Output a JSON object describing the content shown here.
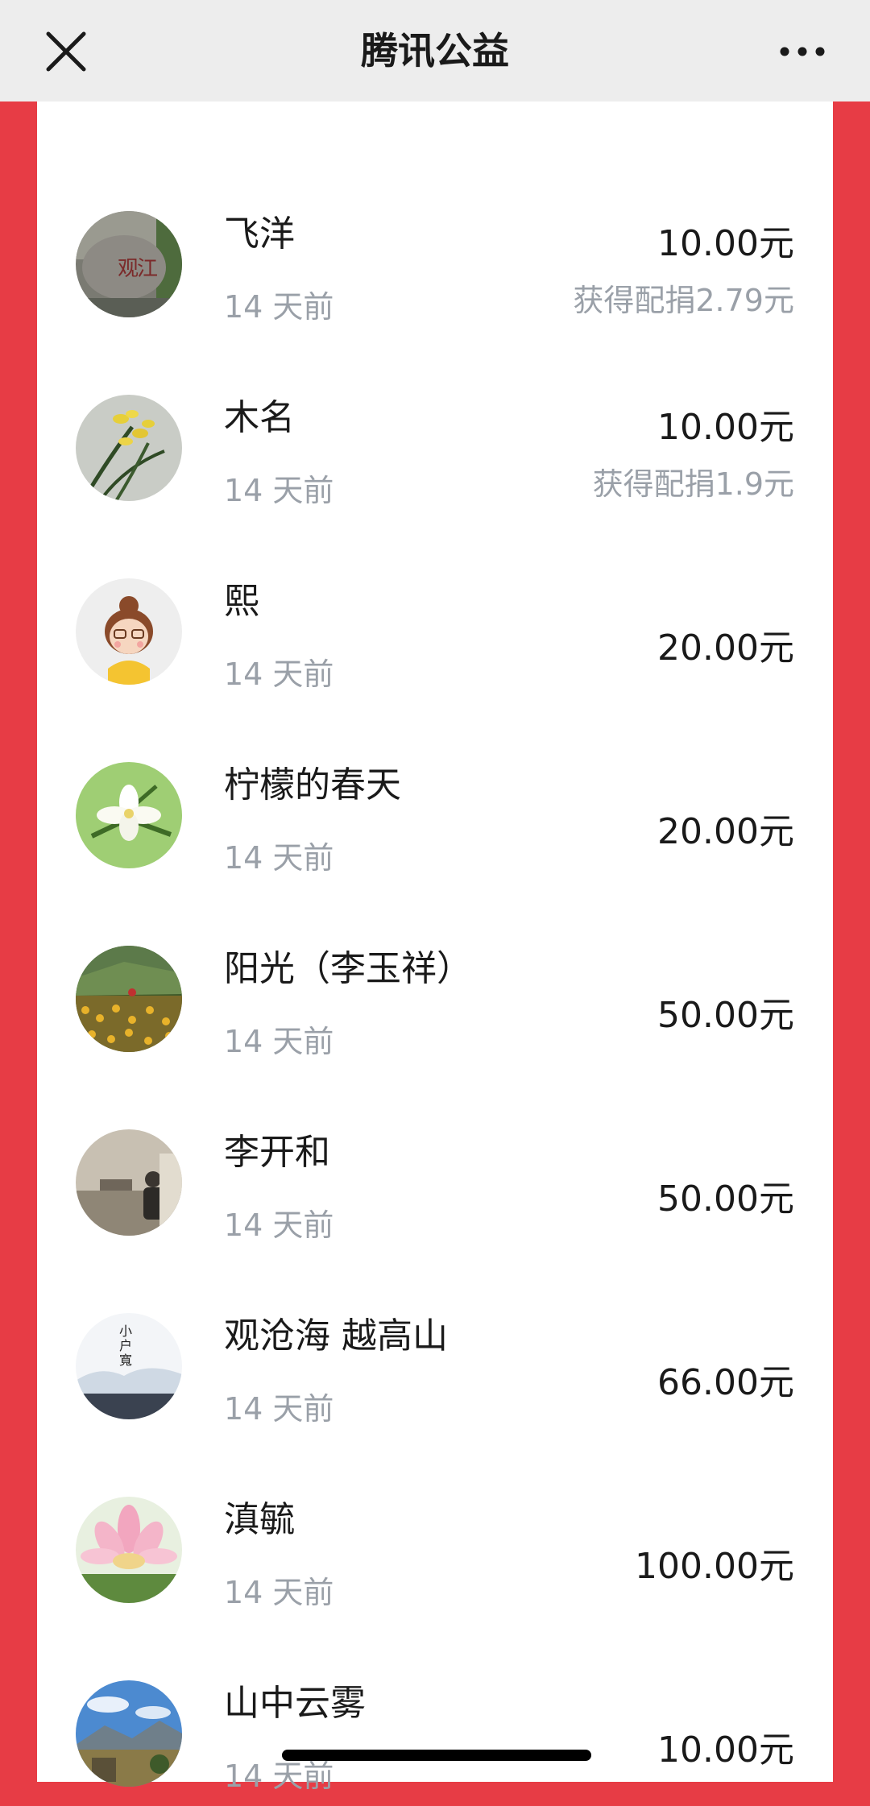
{
  "header": {
    "title": "腾讯公益",
    "close_icon": "close-icon",
    "more_icon": "more-icon"
  },
  "colors": {
    "background": "#e73c45",
    "panel": "#ffffff",
    "header": "#ededed",
    "secondary_text": "#9aa0a8"
  },
  "donations": [
    {
      "name": "飞洋",
      "time": "14 天前",
      "amount": "10.00元",
      "match": "获得配捐2.79元",
      "avatar": "stone-avatar"
    },
    {
      "name": "木名",
      "time": "14 天前",
      "amount": "10.00元",
      "match": "获得配捐1.9元",
      "avatar": "orchid-avatar"
    },
    {
      "name": "熙",
      "time": "14 天前",
      "amount": "20.00元",
      "avatar": "cartoon-girl-avatar"
    },
    {
      "name": "柠檬的春天",
      "time": "14 天前",
      "amount": "20.00元",
      "avatar": "white-flower-avatar"
    },
    {
      "name": "阳光（李玉祥）",
      "time": "14 天前",
      "amount": "50.00元",
      "avatar": "flower-field-avatar"
    },
    {
      "name": "李开和",
      "time": "14 天前",
      "amount": "50.00元",
      "avatar": "person-photo-avatar"
    },
    {
      "name": "观沧海 越高山",
      "time": "14 天前",
      "amount": "66.00元",
      "avatar": "calligraphy-sky-avatar"
    },
    {
      "name": "滇毓",
      "time": "14 天前",
      "amount": "100.00元",
      "avatar": "lotus-avatar"
    },
    {
      "name": "山中云雾",
      "time": "14 天前",
      "amount": "10.00元",
      "avatar": "mountain-avatar"
    }
  ]
}
